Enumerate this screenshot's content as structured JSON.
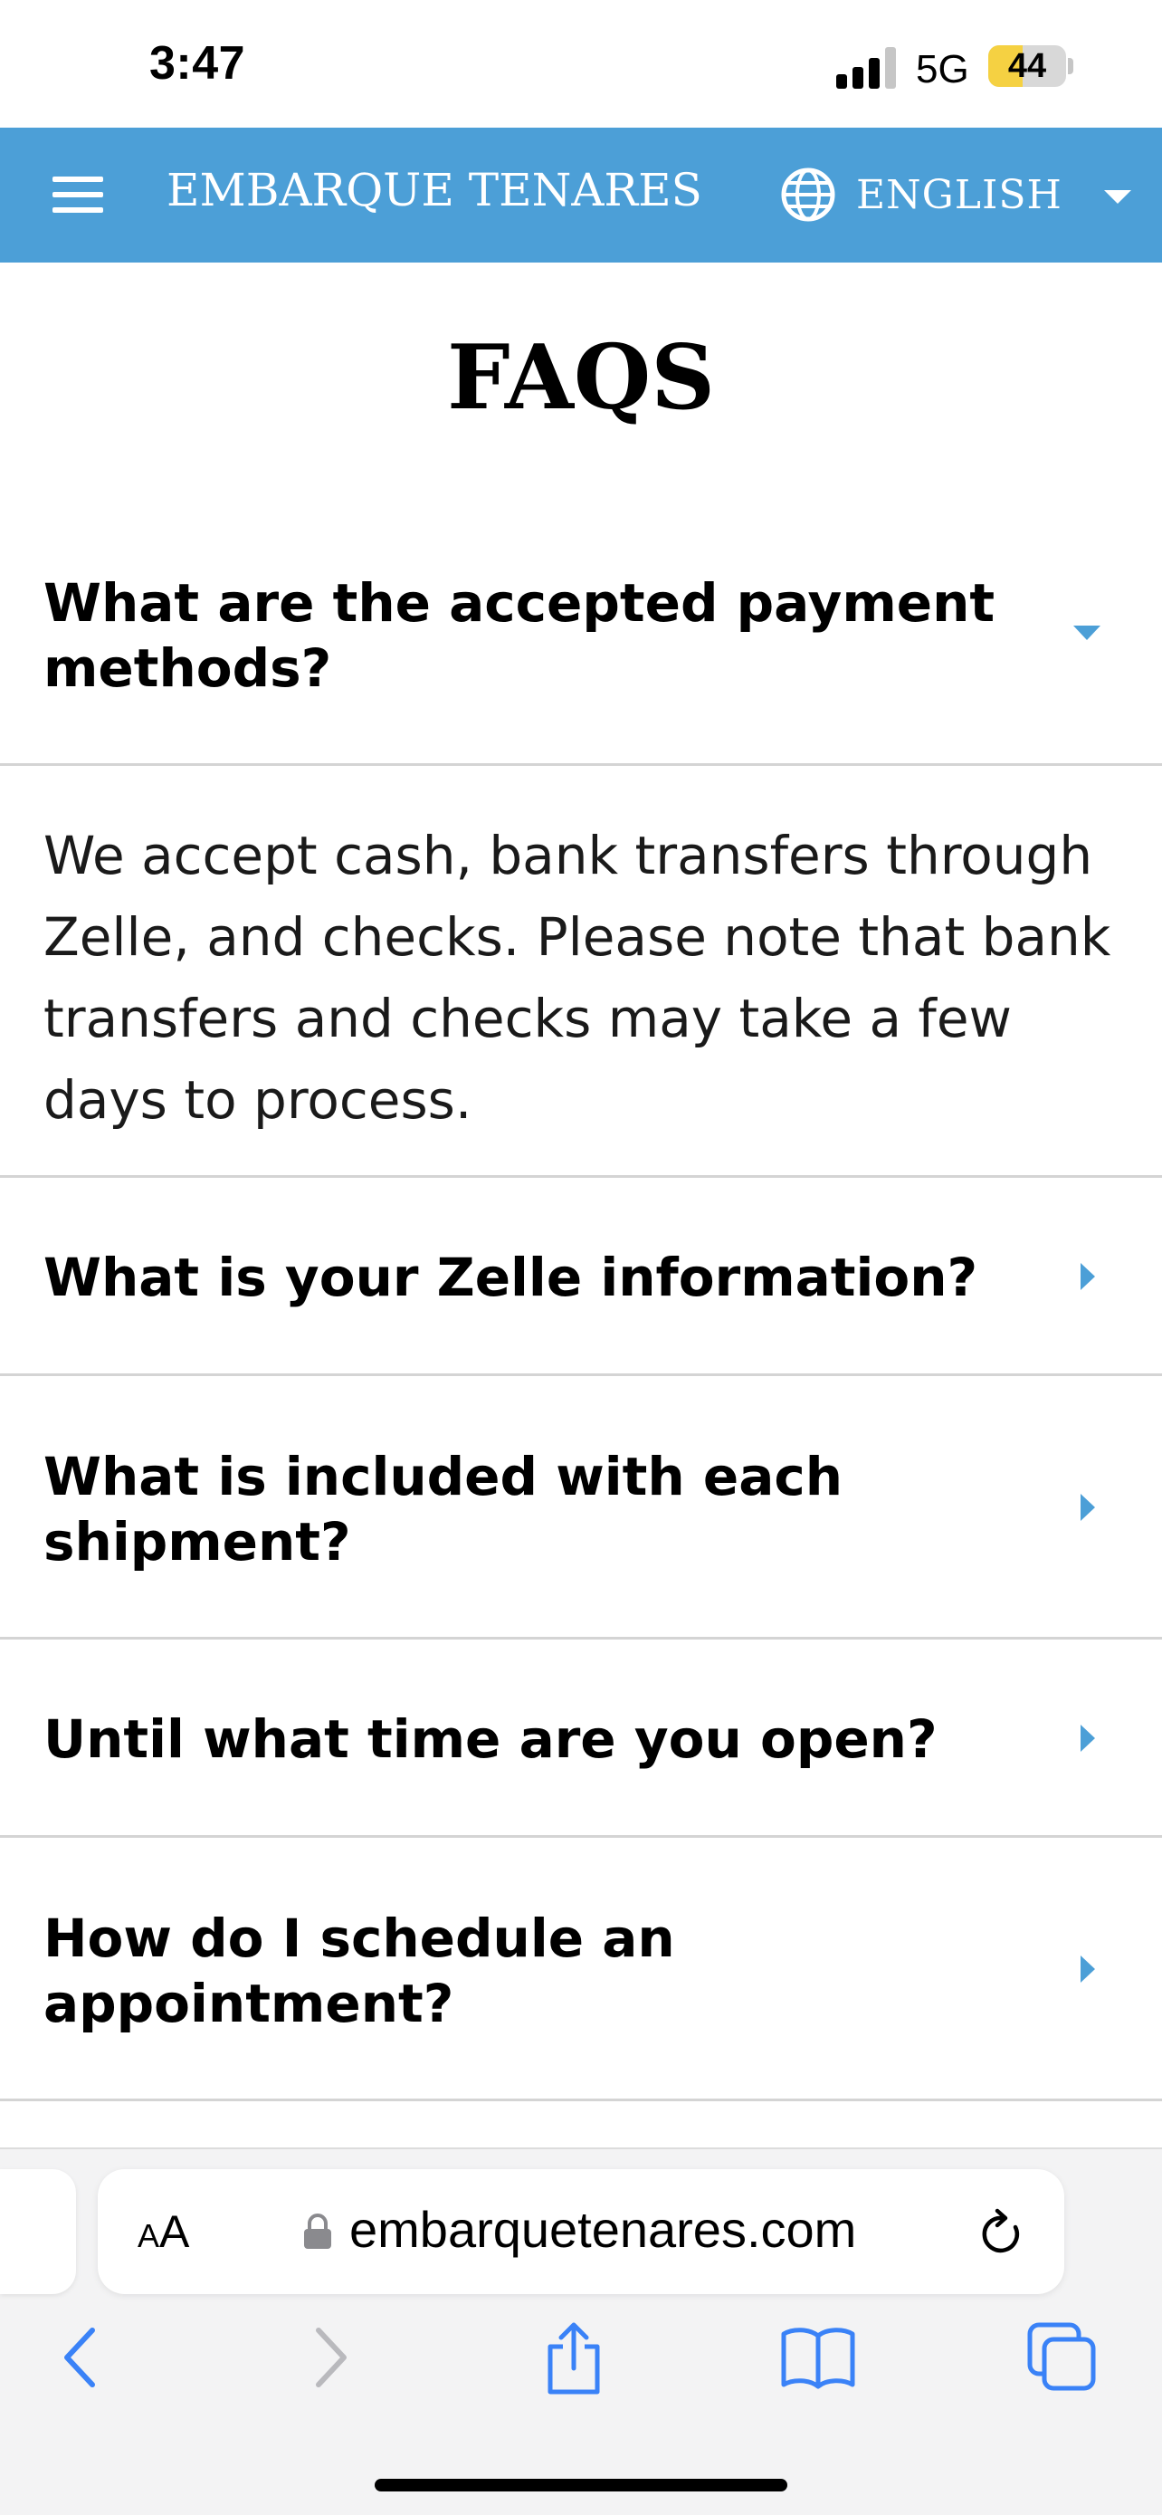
{
  "status_bar": {
    "time": "3:47",
    "network": "5G",
    "battery": "44",
    "battery_level_pct": 44,
    "signal_bars_active": 3,
    "signal_bars_total": 4
  },
  "header": {
    "brand": "EMBARQUE TENARES",
    "language": "ENGLISH",
    "accent_color": "#4c9fd7",
    "icons": [
      "menu-icon",
      "globe-icon",
      "chevron-down-icon"
    ]
  },
  "page": {
    "title": "FAQS"
  },
  "faqs": [
    {
      "question": "What are the accepted payment methods?",
      "expanded": true,
      "answer": "We accept cash, bank transfers through Zelle, and checks. Please note that bank transfers and checks may take a few days to process."
    },
    {
      "question": "What is your Zelle information?",
      "expanded": false
    },
    {
      "question": "What is included with each shipment?",
      "expanded": false
    },
    {
      "question": "Until what time are you open?",
      "expanded": false
    },
    {
      "question": "How do I schedule an appointment?",
      "expanded": false
    }
  ],
  "browser": {
    "text_size_label_small": "A",
    "text_size_label_large": "A",
    "url": "embarquetenares.com",
    "icons": [
      "lock-icon",
      "reload-icon",
      "back-icon",
      "forward-icon",
      "share-icon",
      "bookmarks-icon",
      "tabs-icon"
    ]
  }
}
